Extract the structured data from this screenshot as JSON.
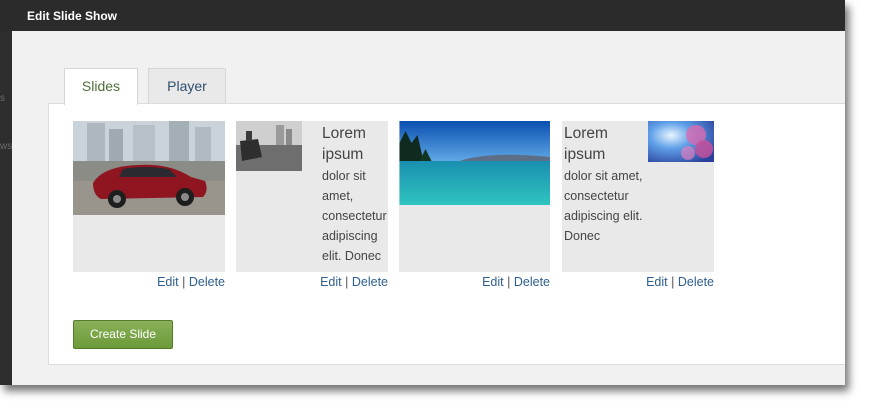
{
  "window": {
    "title": "Edit Slide Show"
  },
  "left_strip": {
    "fragment_1": "s",
    "fragment_2": "ws"
  },
  "tabs": [
    {
      "label": "Slides",
      "active": true
    },
    {
      "label": "Player",
      "active": false
    }
  ],
  "slides": [
    {
      "kind": "image",
      "image": "red-sports-car-city"
    },
    {
      "kind": "image-text",
      "image": "black-white-harbor",
      "title": "Lorem ipsum",
      "body": "dolor sit amet, consectetur adipiscing elit. Donec"
    },
    {
      "kind": "image",
      "image": "turquoise-lake"
    },
    {
      "kind": "text-image",
      "image": "pink-blossom-sky",
      "title": "Lorem ipsum",
      "body": "dolor sit amet, consectetur adipiscing elit. Donec"
    }
  ],
  "actions": {
    "edit": "Edit",
    "separator": "|",
    "delete": "Delete"
  },
  "buttons": {
    "create_slide": "Create Slide"
  },
  "colors": {
    "titlebar": "#2b2b2b",
    "button": "#77a345",
    "active_tab_text": "#4f6f3a",
    "link": "#2f5f8f"
  }
}
